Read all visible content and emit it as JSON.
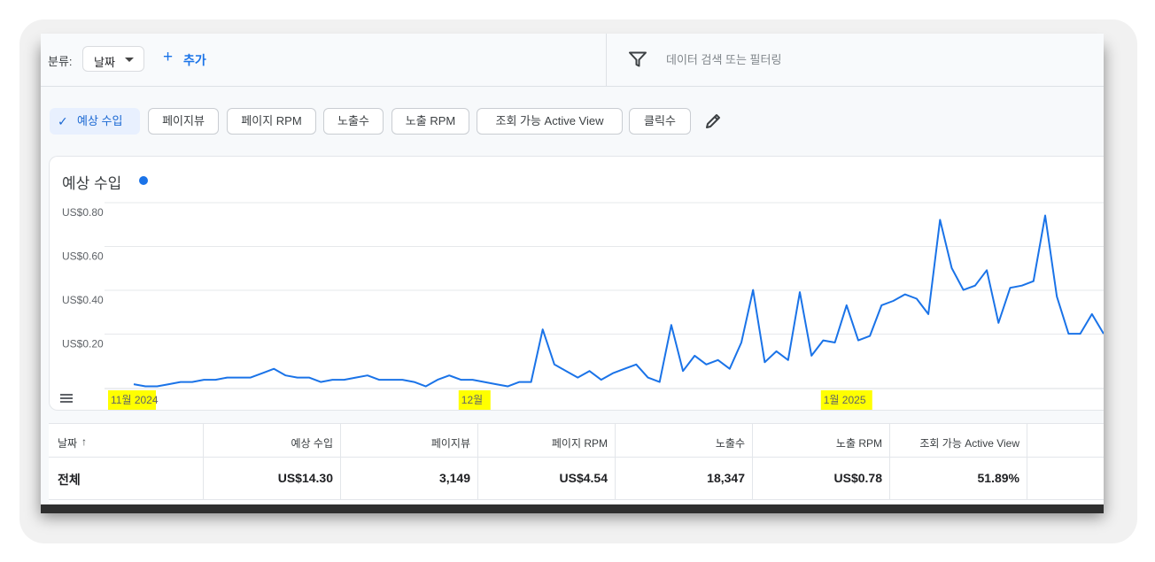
{
  "toolbar": {
    "group_label": "분류:",
    "dimension_value": "날짜",
    "add_label": "추가",
    "filter_placeholder": "데이터 검색 또는 필터링"
  },
  "metrics": [
    {
      "label": "예상 수입",
      "selected": true
    },
    {
      "label": "페이지뷰",
      "selected": false
    },
    {
      "label": "페이지 RPM",
      "selected": false
    },
    {
      "label": "노출수",
      "selected": false
    },
    {
      "label": "노출 RPM",
      "selected": false
    },
    {
      "label": "조회 가능 Active View",
      "selected": false
    },
    {
      "label": "클릭수",
      "selected": false
    }
  ],
  "chart": {
    "title": "예상 수입"
  },
  "chart_data": {
    "type": "line",
    "title": "예상 수입",
    "y_ticks": [
      "US$0.80",
      "US$0.60",
      "US$0.40",
      "US$0.20"
    ],
    "ylim": [
      0,
      0.8
    ],
    "grid": true,
    "x_tick_labels": [
      {
        "label": "11월 2024",
        "index": 0
      },
      {
        "label": "12월",
        "index": 30
      },
      {
        "label": "1월 2025",
        "index": 61
      }
    ],
    "series_color": "#1a73e8",
    "highlight_color": "#ffff00",
    "values": [
      0.02,
      0.01,
      0.01,
      0.02,
      0.03,
      0.03,
      0.04,
      0.04,
      0.05,
      0.05,
      0.05,
      0.07,
      0.09,
      0.06,
      0.05,
      0.05,
      0.03,
      0.04,
      0.04,
      0.05,
      0.06,
      0.04,
      0.04,
      0.04,
      0.03,
      0.01,
      0.04,
      0.06,
      0.04,
      0.04,
      0.03,
      0.02,
      0.01,
      0.03,
      0.03,
      0.27,
      0.11,
      0.08,
      0.05,
      0.08,
      0.04,
      0.07,
      0.09,
      0.11,
      0.05,
      0.03,
      0.29,
      0.08,
      0.15,
      0.11,
      0.13,
      0.09,
      0.21,
      0.45,
      0.12,
      0.17,
      0.13,
      0.44,
      0.15,
      0.22,
      0.21,
      0.38,
      0.22,
      0.24,
      0.38,
      0.4,
      0.43,
      0.41,
      0.34,
      0.77,
      0.55,
      0.45,
      0.47,
      0.54,
      0.3,
      0.46,
      0.47,
      0.49,
      0.79,
      0.42,
      0.25,
      0.25,
      0.34,
      0.25
    ]
  },
  "table": {
    "headers": [
      {
        "label": "날짜",
        "sort": "↑"
      },
      {
        "label": "예상 수입"
      },
      {
        "label": "페이지뷰"
      },
      {
        "label": "페이지 RPM"
      },
      {
        "label": "노출수"
      },
      {
        "label": "노출 RPM"
      },
      {
        "label": "조회 가능 Active View"
      }
    ],
    "total_row": [
      "전체",
      "US$14.30",
      "3,149",
      "US$4.54",
      "18,347",
      "US$0.78",
      "51.89%"
    ]
  }
}
